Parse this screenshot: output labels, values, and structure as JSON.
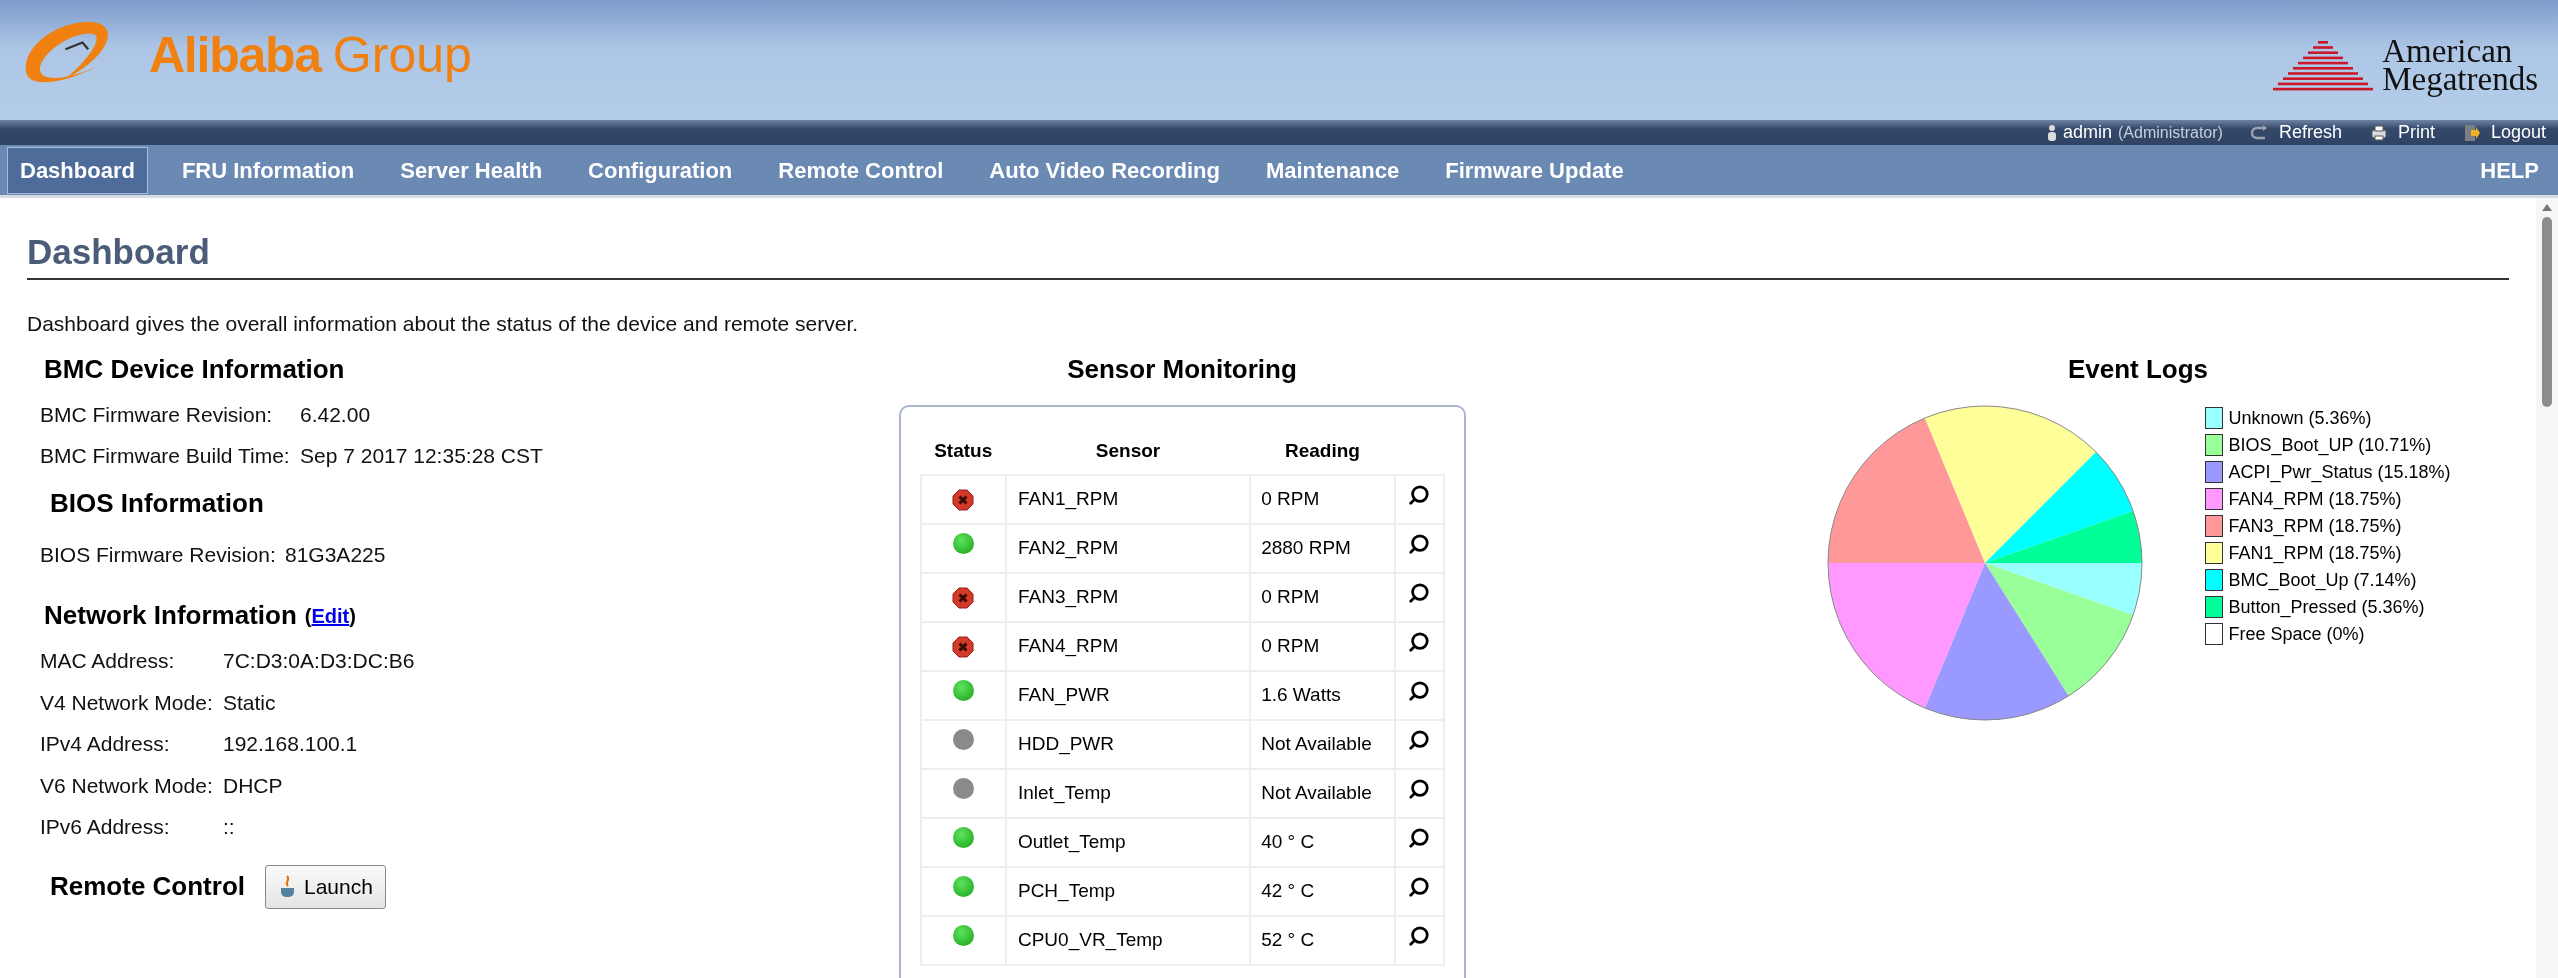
{
  "header": {
    "logo_left": {
      "name": "Alibaba",
      "suffix": "Group"
    },
    "logo_right": {
      "line1": "American",
      "line2": "Megatrends"
    }
  },
  "user_bar": {
    "user": "admin",
    "role": "(Administrator)",
    "actions": [
      {
        "kind": "refresh",
        "label": "Refresh"
      },
      {
        "kind": "print",
        "label": "Print"
      },
      {
        "kind": "logout",
        "label": "Logout"
      }
    ]
  },
  "nav": {
    "items": [
      {
        "label": "Dashboard",
        "selected": true
      },
      {
        "label": "FRU Information",
        "selected": false
      },
      {
        "label": "Server Health",
        "selected": false
      },
      {
        "label": "Configuration",
        "selected": false
      },
      {
        "label": "Remote Control",
        "selected": false
      },
      {
        "label": "Auto Video Recording",
        "selected": false
      },
      {
        "label": "Maintenance",
        "selected": false
      },
      {
        "label": "Firmware Update",
        "selected": false
      }
    ],
    "help": "HELP"
  },
  "page": {
    "title": "Dashboard",
    "description": "Dashboard gives the overall information about the status of the device and remote server."
  },
  "bmc": {
    "heading": "BMC Device Information",
    "rows": [
      {
        "label": "BMC Firmware Revision:",
        "value": "6.42.00"
      },
      {
        "label": "BMC Firmware Build Time:",
        "value": "Sep 7 2017 12:35:28 CST"
      }
    ]
  },
  "bios": {
    "heading": "BIOS Information",
    "rows": [
      {
        "label": "BIOS Firmware Revision:",
        "value": "81G3A225"
      }
    ]
  },
  "network": {
    "heading": "Network Information",
    "edit_open": "(",
    "edit_link": "Edit",
    "edit_close": ")",
    "rows": [
      {
        "label": "MAC Address:",
        "value": "7C:D3:0A:D3:DC:B6"
      },
      {
        "label": "V4 Network Mode:",
        "value": "Static"
      },
      {
        "label": "IPv4 Address:",
        "value": "192.168.100.1"
      },
      {
        "label": "V6 Network Mode:",
        "value": "DHCP"
      },
      {
        "label": "IPv6 Address:",
        "value": "::"
      }
    ]
  },
  "remote_control": {
    "heading": "Remote Control",
    "button": "Launch"
  },
  "sensors": {
    "title": "Sensor Monitoring",
    "columns": [
      "Status",
      "Sensor",
      "Reading"
    ],
    "rows": [
      {
        "kind": "critical",
        "sensor": "FAN1_RPM",
        "reading": "0 RPM"
      },
      {
        "kind": "normal",
        "sensor": "FAN2_RPM",
        "reading": "2880 RPM"
      },
      {
        "kind": "critical",
        "sensor": "FAN3_RPM",
        "reading": "0 RPM"
      },
      {
        "kind": "critical",
        "sensor": "FAN4_RPM",
        "reading": "0 RPM"
      },
      {
        "kind": "normal",
        "sensor": "FAN_PWR",
        "reading": "1.6 Watts"
      },
      {
        "kind": "unavailable",
        "sensor": "HDD_PWR",
        "reading": "Not Available"
      },
      {
        "kind": "unavailable",
        "sensor": "Inlet_Temp",
        "reading": "Not Available"
      },
      {
        "kind": "normal",
        "sensor": "Outlet_Temp",
        "reading": "40 ° C"
      },
      {
        "kind": "normal",
        "sensor": "PCH_Temp",
        "reading": "42 ° C"
      },
      {
        "kind": "normal",
        "sensor": "CPU0_VR_Temp",
        "reading": "52 ° C"
      }
    ]
  },
  "event_logs": {
    "chart_data": {
      "type": "pie",
      "title": "Event Logs",
      "legend": true,
      "categories": [
        "Unknown (5.36%)",
        "BIOS_Boot_UP (10.71%)",
        "ACPI_Pwr_Status (15.18%)",
        "FAN4_RPM (18.75%)",
        "FAN3_RPM (18.75%)",
        "FAN1_RPM (18.75%)",
        "BMC_Boot_Up (7.14%)",
        "Button_Pressed (5.36%)",
        "Free Space (0%)"
      ],
      "values": [
        5.36,
        10.71,
        15.18,
        18.75,
        18.75,
        18.75,
        7.14,
        5.36,
        0
      ],
      "colors": [
        "#99ffff",
        "#99ff99",
        "#9999ff",
        "#ff99ff",
        "#ff9999",
        "#ffff99",
        "#00ffff",
        "#00ff99",
        "#ffffff"
      ]
    }
  }
}
